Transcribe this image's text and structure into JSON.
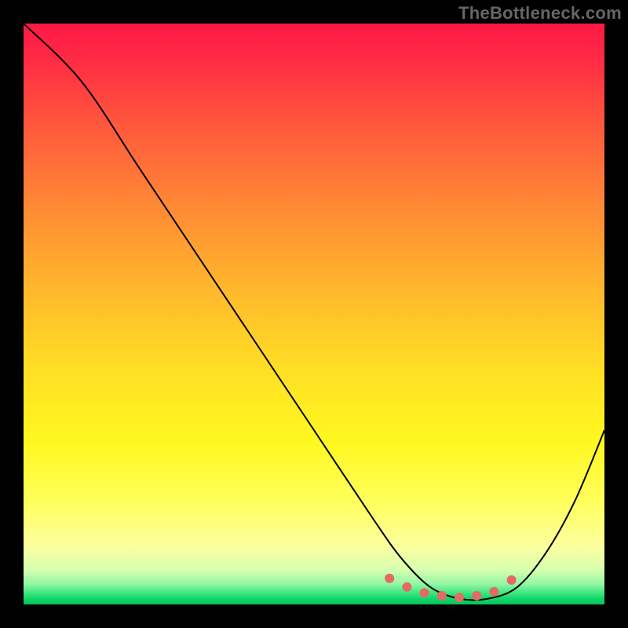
{
  "watermark": "TheBottleneck.com",
  "chart_data": {
    "type": "line",
    "title": "",
    "xlabel": "",
    "ylabel": "",
    "xlim": [
      0,
      100
    ],
    "ylim": [
      0,
      100
    ],
    "grid": false,
    "legend": false,
    "series": [
      {
        "name": "bottleneck-curve",
        "x": [
          0,
          10,
          20,
          30,
          40,
          50,
          60,
          65,
          70,
          75,
          80,
          85,
          90,
          95,
          100
        ],
        "values": [
          100,
          90,
          75,
          60,
          45,
          30,
          15,
          8,
          3,
          1,
          1,
          3,
          9,
          18,
          30
        ]
      }
    ],
    "markers": {
      "name": "optimal-range-dots",
      "color": "#e46a63",
      "x": [
        63,
        66,
        69,
        72,
        75,
        78,
        81,
        84
      ],
      "values": [
        4.5,
        3.0,
        2.0,
        1.5,
        1.2,
        1.5,
        2.2,
        4.2
      ]
    },
    "background_gradient": {
      "stops": [
        {
          "pos": 0,
          "color": "#ff1846"
        },
        {
          "pos": 0.5,
          "color": "#ffc028"
        },
        {
          "pos": 0.8,
          "color": "#ffff5a"
        },
        {
          "pos": 0.96,
          "color": "#93f7a4"
        },
        {
          "pos": 1.0,
          "color": "#08c45d"
        }
      ]
    }
  }
}
